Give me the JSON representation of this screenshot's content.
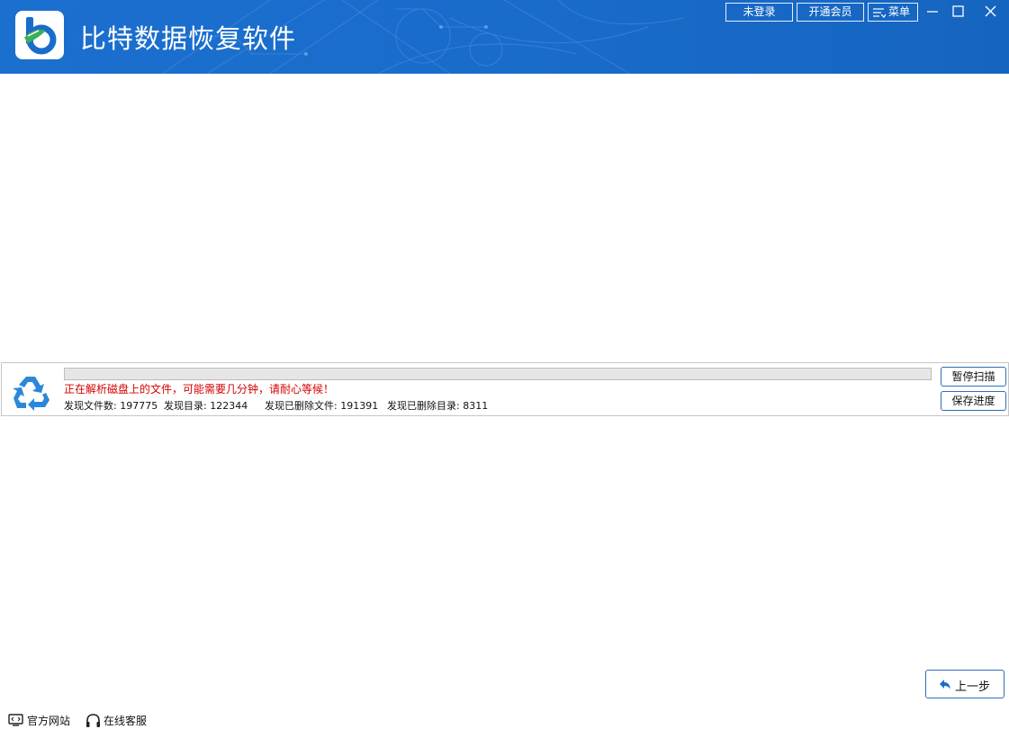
{
  "app": {
    "title": "比特数据恢复软件",
    "accent_color": "#1a6ccb"
  },
  "header": {
    "login_label": "未登录",
    "vip_label": "开通会员",
    "menu_label": "菜单",
    "menu_icon": "menu-icon",
    "minimize_icon": "minimize-icon",
    "maximize_icon": "maximize-icon",
    "close_icon": "close-icon"
  },
  "scan": {
    "icon": "recycle-icon",
    "progress": 0,
    "status_text": "正在解析磁盘上的文件，可能需要几分钟，请耐心等候！",
    "status_color": "#d40000",
    "stats": {
      "files": "发现文件数: 197775",
      "dirs": "发现目录: 122344",
      "deleted_files": "发现已删除文件: 191391",
      "deleted_dirs": "发现已删除目录: 8311"
    },
    "pause_label": "暂停扫描",
    "save_label": "保存进度"
  },
  "nav": {
    "back_label": "上一步",
    "back_icon": "back-arrow-icon"
  },
  "footer": {
    "site_label": "官方网站",
    "site_icon": "website-icon",
    "support_label": "在线客服",
    "support_icon": "headset-icon"
  }
}
